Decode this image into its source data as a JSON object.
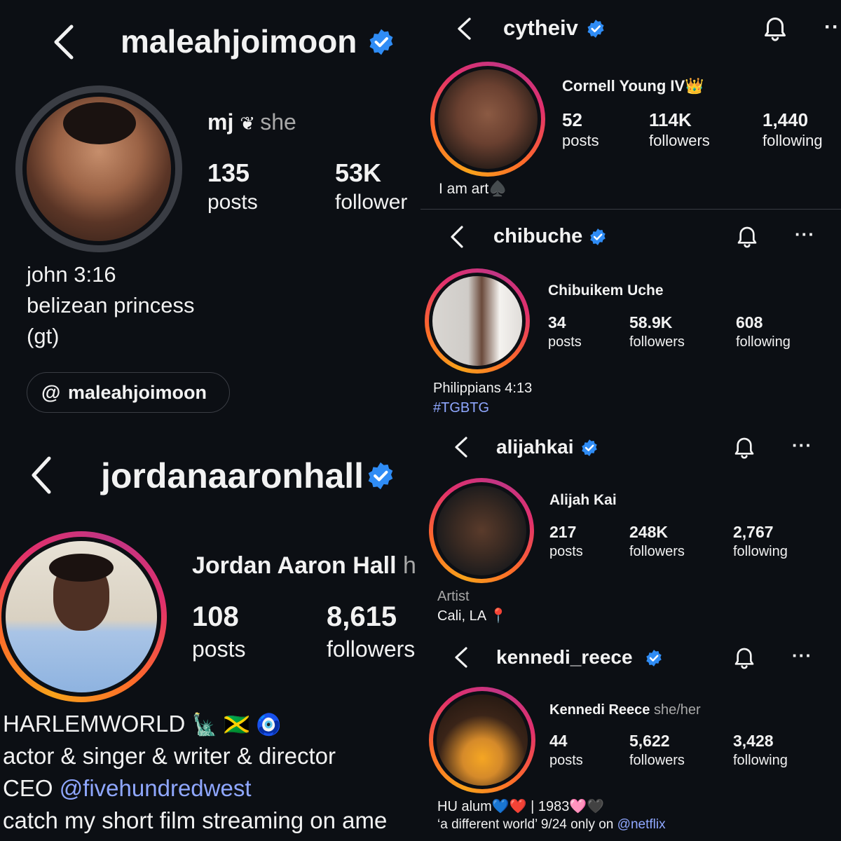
{
  "profiles": {
    "maleahjoimoon": {
      "username": "maleahjoimoon",
      "name": "mj",
      "pronouns": "she",
      "posts": "135",
      "posts_label": "posts",
      "followers": "53K",
      "followers_label": "follower",
      "bio": [
        "john 3:16",
        "belizean princess",
        "(gt)"
      ],
      "threads_handle": "maleahjoimoon"
    },
    "jordanaaronhall": {
      "username": "jordanaaronhall",
      "name": "Jordan Aaron Hall",
      "name_suffix": "h",
      "posts": "108",
      "posts_label": "posts",
      "followers": "8,615",
      "followers_label": "followers",
      "bio_line1": "HARLEMWORLD",
      "bio_line1_emoji": "🗽 🇯🇲 🧿",
      "bio_line2": "actor & singer & writer & director",
      "bio_line3_prefix": "CEO ",
      "bio_line3_link": "@fivehundredwest",
      "bio_line4": "catch my short film streaming on ame"
    },
    "cytheiv": {
      "username": "cytheiv",
      "name": "Cornell Young IV",
      "name_emoji": "👑",
      "posts": "52",
      "posts_label": "posts",
      "followers": "114K",
      "followers_label": "followers",
      "following": "1,440",
      "following_label": "following",
      "bio": "I am art",
      "bio_emoji": "♠️"
    },
    "chibuche": {
      "username": "chibuche",
      "name": "Chibuikem Uche",
      "posts": "34",
      "posts_label": "posts",
      "followers": "58.9K",
      "followers_label": "followers",
      "following": "608",
      "following_label": "following",
      "bio_line1": "Philippians 4:13",
      "bio_line2": "#TGBTG"
    },
    "alijahkai": {
      "username": "alijahkai",
      "name": "Alijah Kai",
      "posts": "217",
      "posts_label": "posts",
      "followers": "248K",
      "followers_label": "followers",
      "following": "2,767",
      "following_label": "following",
      "bio_line1": "Artist",
      "bio_line2": "Cali, LA",
      "bio_line2_emoji": "📍"
    },
    "kennedi_reece": {
      "username": "kennedi_reece",
      "name": "Kennedi Reece",
      "pronouns": "she/her",
      "posts": "44",
      "posts_label": "posts",
      "followers": "5,622",
      "followers_label": "followers",
      "following": "3,428",
      "following_label": "following",
      "bio_line1": "HU alum",
      "bio_line1_emoji": "💙❤️",
      "bio_line1_mid": "| 1983",
      "bio_line1_emoji2": "🩷🖤",
      "bio_line2_prefix": "‘a different world’ 9/24 only on ",
      "bio_line2_link": "@netflix"
    }
  },
  "icons": {
    "back": "chevron-left-icon",
    "verified": "verified-badge-icon",
    "bell": "bell-icon",
    "more": "more-icon",
    "threads": "threads-icon"
  },
  "colors": {
    "background": "#0b0d12",
    "verified": "#2f8cf5",
    "link": "#8fa7ff"
  }
}
